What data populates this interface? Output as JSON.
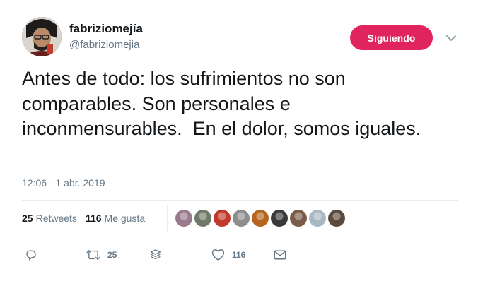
{
  "author": {
    "display_name": "fabriziomejía",
    "handle": "@fabriziomejia",
    "avatar_icon": "profile-photo"
  },
  "follow_button": {
    "label": "Siguiendo",
    "color": "#e0245e"
  },
  "caret_icon": "chevron-down-icon",
  "tweet": {
    "text": "Antes de todo: los sufrimientos no son comparables. Son personales e inconmensurables.  En el dolor, somos iguales.",
    "timestamp": "12:06 - 1 abr. 2019"
  },
  "stats": {
    "retweets_count": "25",
    "retweets_label": "Retweets",
    "likes_count": "116",
    "likes_label": "Me gusta"
  },
  "likers": [
    {
      "name": "liker-1",
      "color": "#9a7b8c"
    },
    {
      "name": "liker-2",
      "color": "#6f7a6a"
    },
    {
      "name": "liker-3",
      "color": "#c0392b"
    },
    {
      "name": "liker-4",
      "color": "#8d8d8d"
    },
    {
      "name": "liker-5",
      "color": "#b5651d"
    },
    {
      "name": "liker-6",
      "color": "#3a3a3a"
    },
    {
      "name": "liker-7",
      "color": "#7a5c4a"
    },
    {
      "name": "liker-8",
      "color": "#aab8c2"
    },
    {
      "name": "liker-9",
      "color": "#5b4a3c"
    }
  ],
  "actions": {
    "reply_icon": "reply-icon",
    "retweet_icon": "retweet-icon",
    "retweet_count": "25",
    "thread_icon": "thread-icon",
    "like_icon": "heart-icon",
    "like_count": "116",
    "dm_icon": "envelope-icon"
  },
  "colors": {
    "text_primary": "#14171a",
    "text_secondary": "#657786",
    "divider": "#e6ecf0"
  }
}
